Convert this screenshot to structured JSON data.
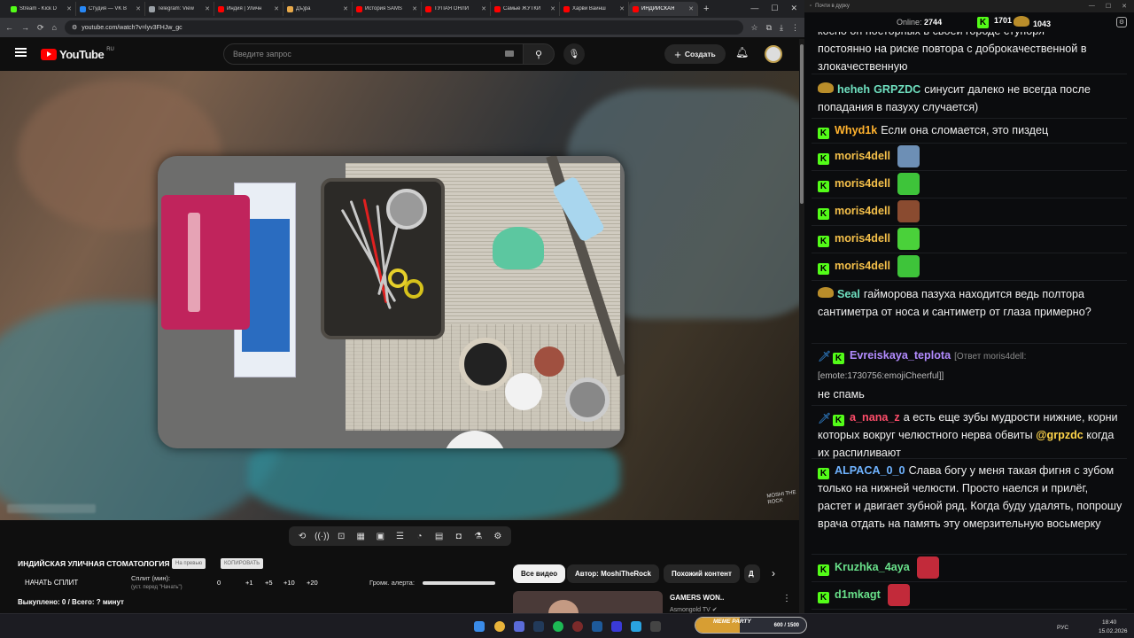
{
  "browser": {
    "tabs": [
      {
        "label": "Stream - Kick D",
        "color": "#53fc18"
      },
      {
        "label": "Студия — VK В",
        "color": "#2787f5"
      },
      {
        "label": "Telegram: View",
        "color": "#9aa0a6"
      },
      {
        "label": "Индия | Уличн",
        "color": "#ff0000"
      },
      {
        "label": "Дъ)ра",
        "color": "#e8a94a"
      },
      {
        "label": "История SAMS",
        "color": "#ff0000"
      },
      {
        "label": "ТУПАЯ ОНЛИ",
        "color": "#ff0000"
      },
      {
        "label": "Самые ЖУТКИ",
        "color": "#ff0000"
      },
      {
        "label": "Харви Вайнш",
        "color": "#ff0000"
      },
      {
        "label": "ИНДИЙСКАЯ",
        "color": "#ff0000"
      }
    ],
    "url": "youtube.com/watch?v=lyv3FHJw_gc"
  },
  "youtube": {
    "logo": "YouTube",
    "region": "RU",
    "search_placeholder": "Введите запрос",
    "create_label": "Создать",
    "video_title": "ИНДИЙСКАЯ УЛИЧНАЯ СТОМАТОЛОГИЯ",
    "pill1": "На превью",
    "pill2": "КОПИРОВАТЬ",
    "start_split": "НАЧАТЬ СПЛИТ",
    "split_label": "Сплит (мин):",
    "split_sub": "(уст. перед \"Начать\")",
    "split_values": [
      "0",
      "+1",
      "+5",
      "+10",
      "+20"
    ],
    "volume_label": "Громк. алерта:",
    "buyout": "Выкуплено: 0 / Всего: ? минут",
    "watermark": "MOSHI THE ROCK",
    "chips": [
      "Все видео",
      "Автор: MoshiTheRock",
      "Похожий контент",
      "Д"
    ],
    "next": {
      "title": "GAMERS WON..",
      "channel": "Asmongold TV"
    }
  },
  "chat": {
    "window_title": "Почти в дурку",
    "online_label": "Online:",
    "online": "2744",
    "count1": "1701",
    "count2": "1043",
    "messages": [
      {
        "top_line": "косно он посторных в своей городе ступоря",
        "text": "постоянно на риске повтора с доброкачественной в злокачественную"
      },
      {
        "badge": "bag",
        "user": "heheh",
        "user2": "GRPZDC",
        "color": "#6fe0c0",
        "text": "синусит далеко не всегда после попадания в пазуху случается)"
      },
      {
        "badge": "kick",
        "user": "Whyd1k",
        "color": "#ffb22e",
        "text": "Если она сломается, это пиздец"
      },
      {
        "badge": "kick",
        "user": "moris4dell",
        "color": "#f5c04a",
        "emote": "#6d8fb5"
      },
      {
        "badge": "kick",
        "user": "moris4dell",
        "color": "#f5c04a",
        "emote": "#3ec43a"
      },
      {
        "badge": "kick",
        "user": "moris4dell",
        "color": "#f5c04a",
        "emote": "#8a4b30"
      },
      {
        "badge": "kick",
        "user": "moris4dell",
        "color": "#f5c04a",
        "emote": "#4ad13a"
      },
      {
        "badge": "kick",
        "user": "moris4dell",
        "color": "#f5c04a",
        "emote": "#3ec43a"
      },
      {
        "badge": "bag",
        "user": "Seal",
        "color": "#6fe0c0",
        "text": "гайморова пазуха находится ведь полтора сантиметра от носа и сантиметр от глаза примерно?"
      },
      {
        "badge": "swordkick",
        "user": "Evreiskaya_teplota",
        "color": "#b38cff",
        "reply": "[Ответ moris4dell:",
        "emote_text": "[emote:1730756:emojiCheerful]]",
        "text": "не спамь"
      },
      {
        "badge": "swordkick",
        "user": "a_nana_z",
        "color": "#ff4d6a",
        "text_before": "а есть еще зубы мудрости нижние, корни которых вокруг челюстного нерва обвиты",
        "mention": "@grpzdc",
        "text_after": "когда их распиливают"
      },
      {
        "badge": "kick",
        "user": "ALPACA_0_0",
        "color": "#6fb3ff",
        "text": "Слава богу у меня такая фигня с зубом только на нижней челюсти. Просто наелся и прилёг, растет и двигает зубной ряд. Когда буду удалять, попрошу врача отдать на память эту омерзительную восьмерку"
      },
      {
        "badge": "kick",
        "user": "Kruzhka_4aya",
        "color": "#69e08a",
        "emote": "#c22a3a"
      },
      {
        "badge": "kick",
        "user": "d1mkagt",
        "color": "#69e08a",
        "emote": "#c22a3a"
      }
    ]
  },
  "taskbar": {
    "meme_party_label": "MEME PARTY",
    "meme_party_progress": "600 / 1500",
    "meme_party_fraction": 0.4,
    "lang": "РУС",
    "time": "18:40",
    "date": "15.02.2026"
  }
}
